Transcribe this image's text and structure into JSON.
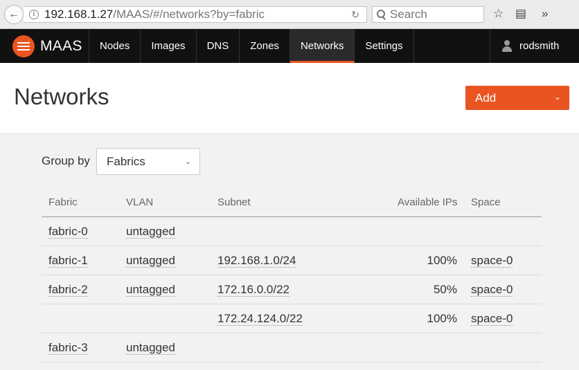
{
  "browser": {
    "url_host": "192.168.1.27",
    "url_path": "/MAAS/#/networks?by=fabric",
    "search_placeholder": "Search"
  },
  "nav": {
    "brand": "MAAS",
    "items": [
      "Nodes",
      "Images",
      "DNS",
      "Zones",
      "Networks",
      "Settings"
    ],
    "active": "Networks",
    "user": "rodsmith"
  },
  "page": {
    "title": "Networks",
    "add_label": "Add",
    "group_by_label": "Group by",
    "group_by_value": "Fabrics"
  },
  "table": {
    "headers": [
      "Fabric",
      "VLAN",
      "Subnet",
      "Available IPs",
      "Space"
    ],
    "rows": [
      {
        "fabric": "fabric-0",
        "vlan": "untagged",
        "subnet": "",
        "available": "",
        "space": ""
      },
      {
        "fabric": "fabric-1",
        "vlan": "untagged",
        "subnet": "192.168.1.0/24",
        "available": "100%",
        "space": "space-0"
      },
      {
        "fabric": "fabric-2",
        "vlan": "untagged",
        "subnet": "172.16.0.0/22",
        "available": "50%",
        "space": "space-0"
      },
      {
        "fabric": "",
        "vlan": "",
        "subnet": "172.24.124.0/22",
        "available": "100%",
        "space": "space-0"
      },
      {
        "fabric": "fabric-3",
        "vlan": "untagged",
        "subnet": "",
        "available": "",
        "space": ""
      }
    ]
  },
  "colors": {
    "accent": "#e95420",
    "nav_bg": "#111111"
  }
}
